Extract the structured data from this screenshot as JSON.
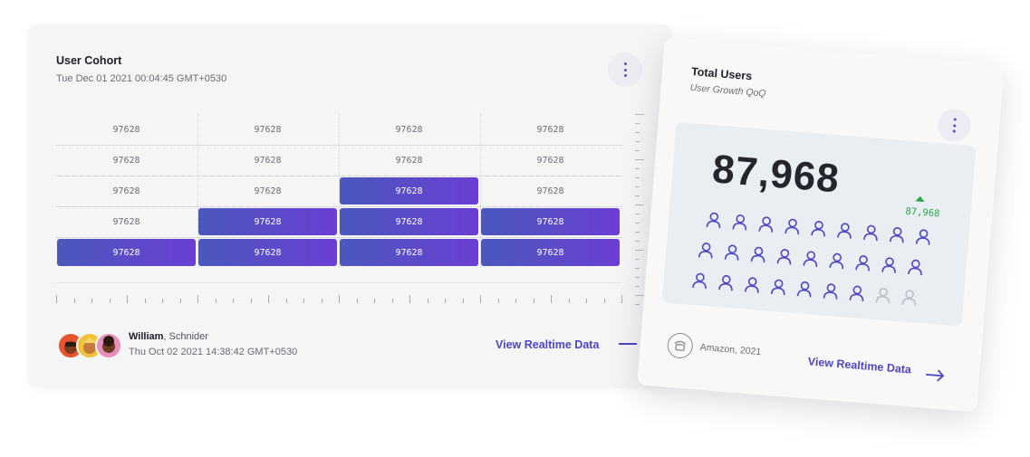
{
  "cohort": {
    "title": "User Cohort",
    "subtitle": "Tue Dec 01 2021 00:04:45 GMT+0530",
    "menu_icon": "kebab-vertical-icon",
    "grid": {
      "rows": [
        {
          "cells": [
            "97628",
            "97628",
            "97628",
            "97628"
          ],
          "highlight": [
            false,
            false,
            false,
            false
          ]
        },
        {
          "cells": [
            "97628",
            "97628",
            "97628",
            "97628"
          ],
          "highlight": [
            false,
            false,
            false,
            false
          ]
        },
        {
          "cells": [
            "97628",
            "97628",
            "97628",
            "97628"
          ],
          "highlight": [
            false,
            false,
            true,
            false
          ]
        },
        {
          "cells": [
            "97628",
            "97628",
            "97628",
            "97628"
          ],
          "highlight": [
            false,
            true,
            true,
            true
          ]
        },
        {
          "cells": [
            "97628",
            "97628",
            "97628",
            "97628"
          ],
          "highlight": [
            true,
            true,
            true,
            true
          ]
        }
      ]
    },
    "footer": {
      "user_first": "William",
      "user_last": ", Schnider",
      "date": "Thu Oct 02 2021 14:38:42 GMT+0530",
      "view_label": "View Realtime Data"
    }
  },
  "total_users": {
    "title": "Total Users",
    "subtitle": "User Growth QoQ",
    "menu_icon": "kebab-vertical-icon",
    "value": "87,968",
    "delta": "87,968",
    "delta_direction": "up",
    "people": {
      "total": 28,
      "active": 25
    },
    "company": "Amazon, 2021",
    "view_label": "View Realtime Data"
  },
  "colors": {
    "accent": "#4f45c4",
    "bar_start": "#4a58bd",
    "bar_end": "#6b3fd3",
    "positive": "#28a745",
    "inactive_person": "#b8bfc8"
  }
}
